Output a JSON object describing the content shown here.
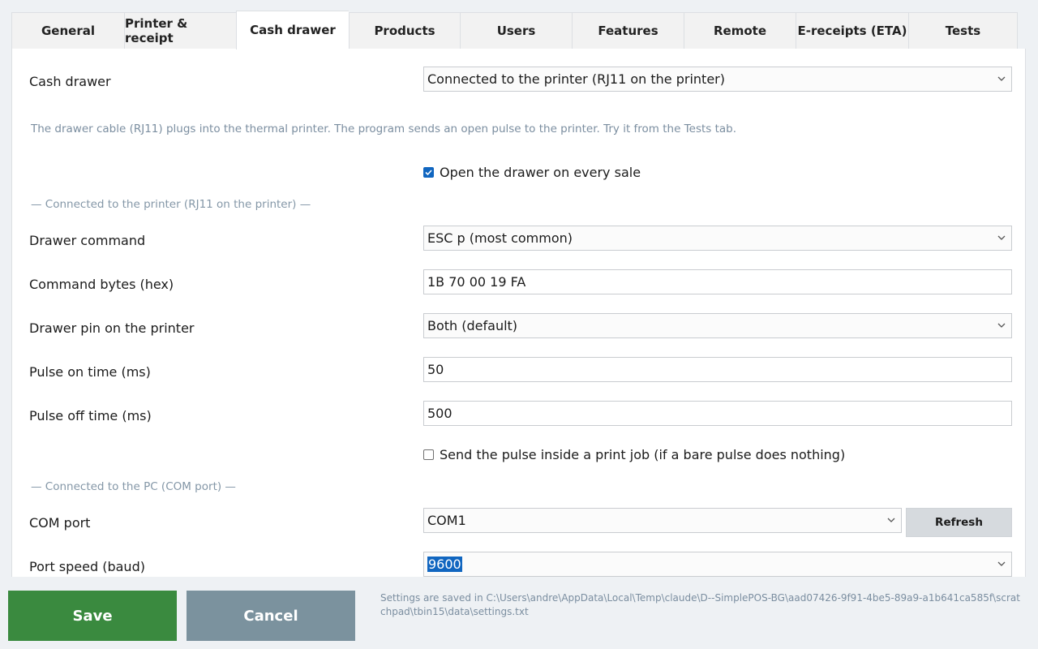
{
  "tabs": [
    {
      "label": "General"
    },
    {
      "label": "Printer & receipt"
    },
    {
      "label": "Cash drawer"
    },
    {
      "label": "Products"
    },
    {
      "label": "Users"
    },
    {
      "label": "Features"
    },
    {
      "label": "Remote"
    },
    {
      "label": "E-receipts (ETA)"
    },
    {
      "label": "Tests"
    }
  ],
  "active_tab": "Cash drawer",
  "form": {
    "cash_drawer_label": "Cash drawer",
    "cash_drawer_value": "Connected to the printer (RJ11 on the printer)",
    "hint": "The drawer cable (RJ11) plugs into the thermal printer. The program sends an open pulse to the printer. Try it from the Tests tab.",
    "open_every_sale_label": "Open the drawer on every sale",
    "open_every_sale_checked": true,
    "section_printer": "— Connected to the printer (RJ11 on the printer) —",
    "drawer_command_label": "Drawer command",
    "drawer_command_value": "ESC p (most common)",
    "command_bytes_label": "Command bytes (hex)",
    "command_bytes_value": "1B 70 00 19 FA",
    "drawer_pin_label": "Drawer pin on the printer",
    "drawer_pin_value": "Both (default)",
    "pulse_on_label": "Pulse on time (ms)",
    "pulse_on_value": "50",
    "pulse_off_label": "Pulse off time (ms)",
    "pulse_off_value": "500",
    "pulse_in_print_job_label": "Send the pulse inside a print job (if a bare pulse does nothing)",
    "pulse_in_print_job_checked": false,
    "section_pc": "— Connected to the PC (COM port) —",
    "com_port_label": "COM port",
    "com_port_value": "COM1",
    "refresh_label": "Refresh",
    "port_speed_label": "Port speed (baud)",
    "port_speed_value": "9600"
  },
  "footer": {
    "save_label": "Save",
    "cancel_label": "Cancel",
    "settings_info": "Settings are saved in C:\\Users\\andre\\AppData\\Local\\Temp\\claude\\D--SimplePOS-BG\\aad07426-9f91-4be5-89a9-a1b641ca585f\\scratchpad\\tbin15\\data\\settings.txt"
  },
  "colors": {
    "accent": "#1166c0",
    "save": "#3a8a3f",
    "cancel": "#7b929e",
    "hint": "#7b8ea0"
  }
}
